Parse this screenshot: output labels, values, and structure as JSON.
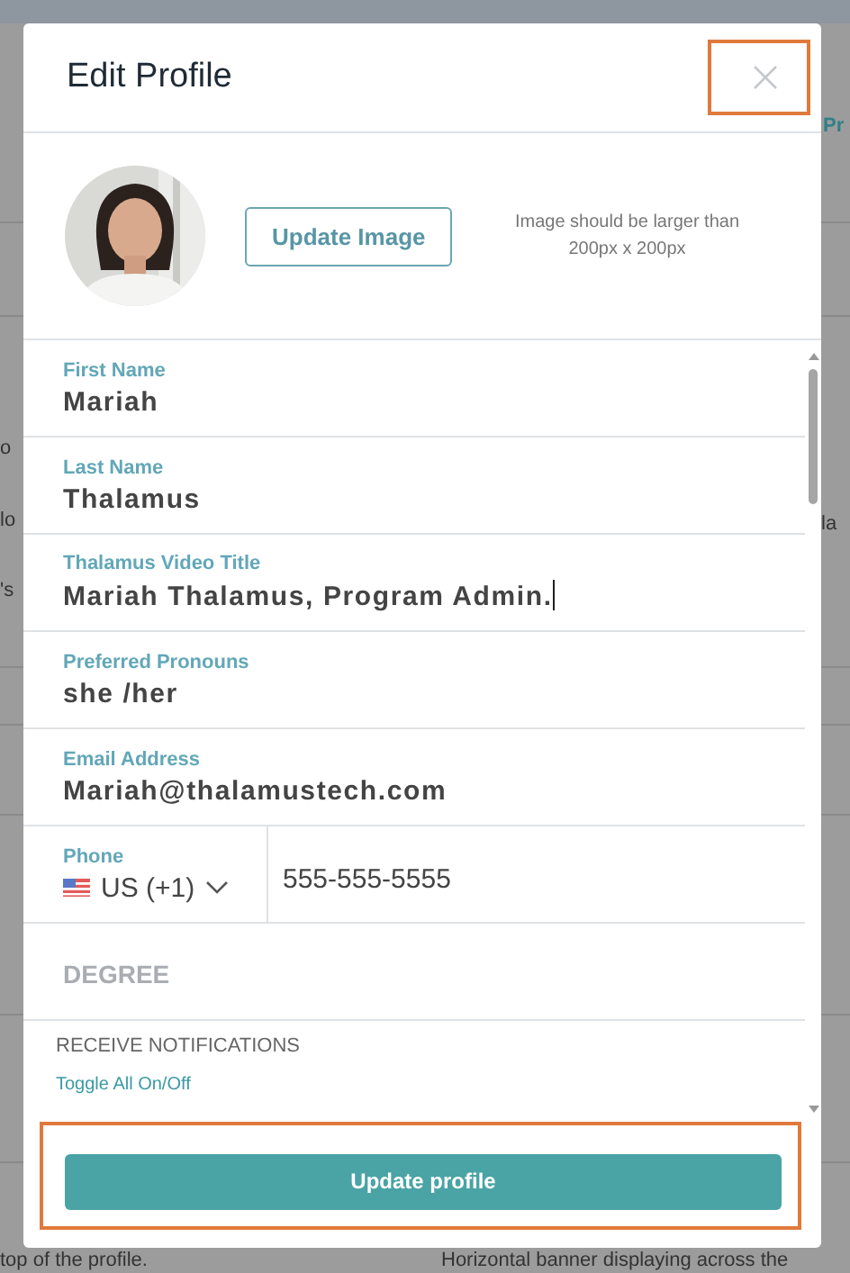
{
  "background_texts": [
    "Pr",
    "o",
    "lo",
    "la",
    "'s",
    "top of the profile.",
    "Horizontal banner displaying across the"
  ],
  "modal": {
    "title": "Edit Profile",
    "image_button": "Update Image",
    "image_hint": "Image should be larger than 200px x 200px",
    "fields": [
      {
        "kind": "text",
        "label": "First Name",
        "value": "Mariah",
        "focused": false
      },
      {
        "kind": "text",
        "label": "Last Name",
        "value": "Thalamus",
        "focused": false
      },
      {
        "kind": "text",
        "label": "Thalamus Video Title",
        "value": "Mariah Thalamus, Program Admin.",
        "focused": true
      },
      {
        "kind": "text",
        "label": "Preferred Pronouns",
        "value": "she /her",
        "focused": false
      },
      {
        "kind": "text",
        "label": "Email Address",
        "value": "Mariah@thalamustech.com",
        "focused": false
      },
      {
        "kind": "phone",
        "label": "Phone",
        "country": "US (+1)",
        "value": "555-555-5555"
      },
      {
        "kind": "empty",
        "placeholder": "DEGREE"
      }
    ],
    "notifications": {
      "heading": "RECEIVE NOTIFICATIONS",
      "toggle_link": "Toggle All On/Off"
    },
    "submit": "Update profile"
  }
}
